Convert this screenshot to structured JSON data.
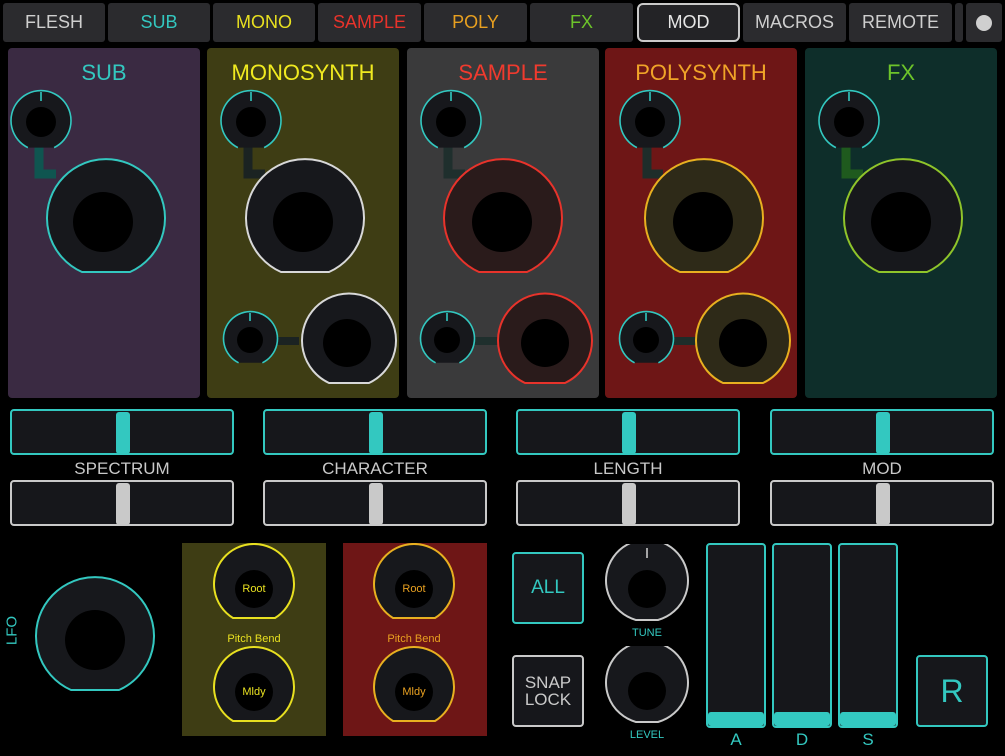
{
  "tabs": [
    {
      "label": "FLESH",
      "color": "#cfcfcf"
    },
    {
      "label": "SUB",
      "color": "#33c8c0"
    },
    {
      "label": "MONO",
      "color": "#e8e020"
    },
    {
      "label": "SAMPLE",
      "color": "#e8332b"
    },
    {
      "label": "POLY",
      "color": "#e8a020"
    },
    {
      "label": "FX",
      "color": "#6dc42a"
    },
    {
      "label": "MOD",
      "color": "#e6e6e6"
    },
    {
      "label": "MACROS",
      "color": "#cfcfcf"
    },
    {
      "label": "REMOTE",
      "color": "#cfcfcf"
    }
  ],
  "panels": [
    {
      "title": "SUB",
      "title_color": "#33c8c0",
      "bg": "#3a2a42",
      "ring": "#33c8c0",
      "has_lower": false
    },
    {
      "title": "MONOSYNTH",
      "title_color": "#f0ea20",
      "bg": "#3e3d14",
      "ring": "#d8d8d8",
      "has_lower": true
    },
    {
      "title": "SAMPLE",
      "title_color": "#f03a2e",
      "bg": "#3a3a3b",
      "ring": "#e8332b",
      "has_lower": true
    },
    {
      "title": "POLYSYNTH",
      "title_color": "#f0a428",
      "bg": "#6e1616",
      "ring": "#e8b020",
      "has_lower": true
    },
    {
      "title": "FX",
      "title_color": "#6dc42a",
      "bg": "#0e2e2a",
      "ring": "#8fc42a",
      "has_lower": false
    }
  ],
  "macros": [
    {
      "label": "SPECTRUM",
      "value": 0.5,
      "mod_value": 0.5
    },
    {
      "label": "CHARACTER",
      "value": 0.5,
      "mod_value": 0.5
    },
    {
      "label": "LENGTH",
      "value": 0.5,
      "mod_value": 0.5
    },
    {
      "label": "MOD",
      "value": 0.5,
      "mod_value": 0.5
    }
  ],
  "lfo": {
    "label": "LFO"
  },
  "pitch_panels": [
    {
      "root_label": "Root",
      "bend_label": "Pitch Bend",
      "mldy_label": "Mldy",
      "bg": "#3e3d14",
      "ring": "#e8e020",
      "text_color": "#e8e020"
    },
    {
      "root_label": "Root",
      "bend_label": "Pitch Bend",
      "mldy_label": "Mldy",
      "bg": "#6e1616",
      "ring": "#e8b020",
      "text_color": "#e8a020"
    }
  ],
  "buttons": {
    "all": "ALL",
    "snap_lock": "SNAP\nLOCK",
    "r": "R"
  },
  "knobs": {
    "tune": "TUNE",
    "level": "LEVEL"
  },
  "envelope": [
    {
      "label": "A",
      "value": 0.0
    },
    {
      "label": "D",
      "value": 0.0
    },
    {
      "label": "S",
      "value": 0.0
    }
  ],
  "colors": {
    "accent": "#33c8c0",
    "gray": "#c9c9c9"
  }
}
